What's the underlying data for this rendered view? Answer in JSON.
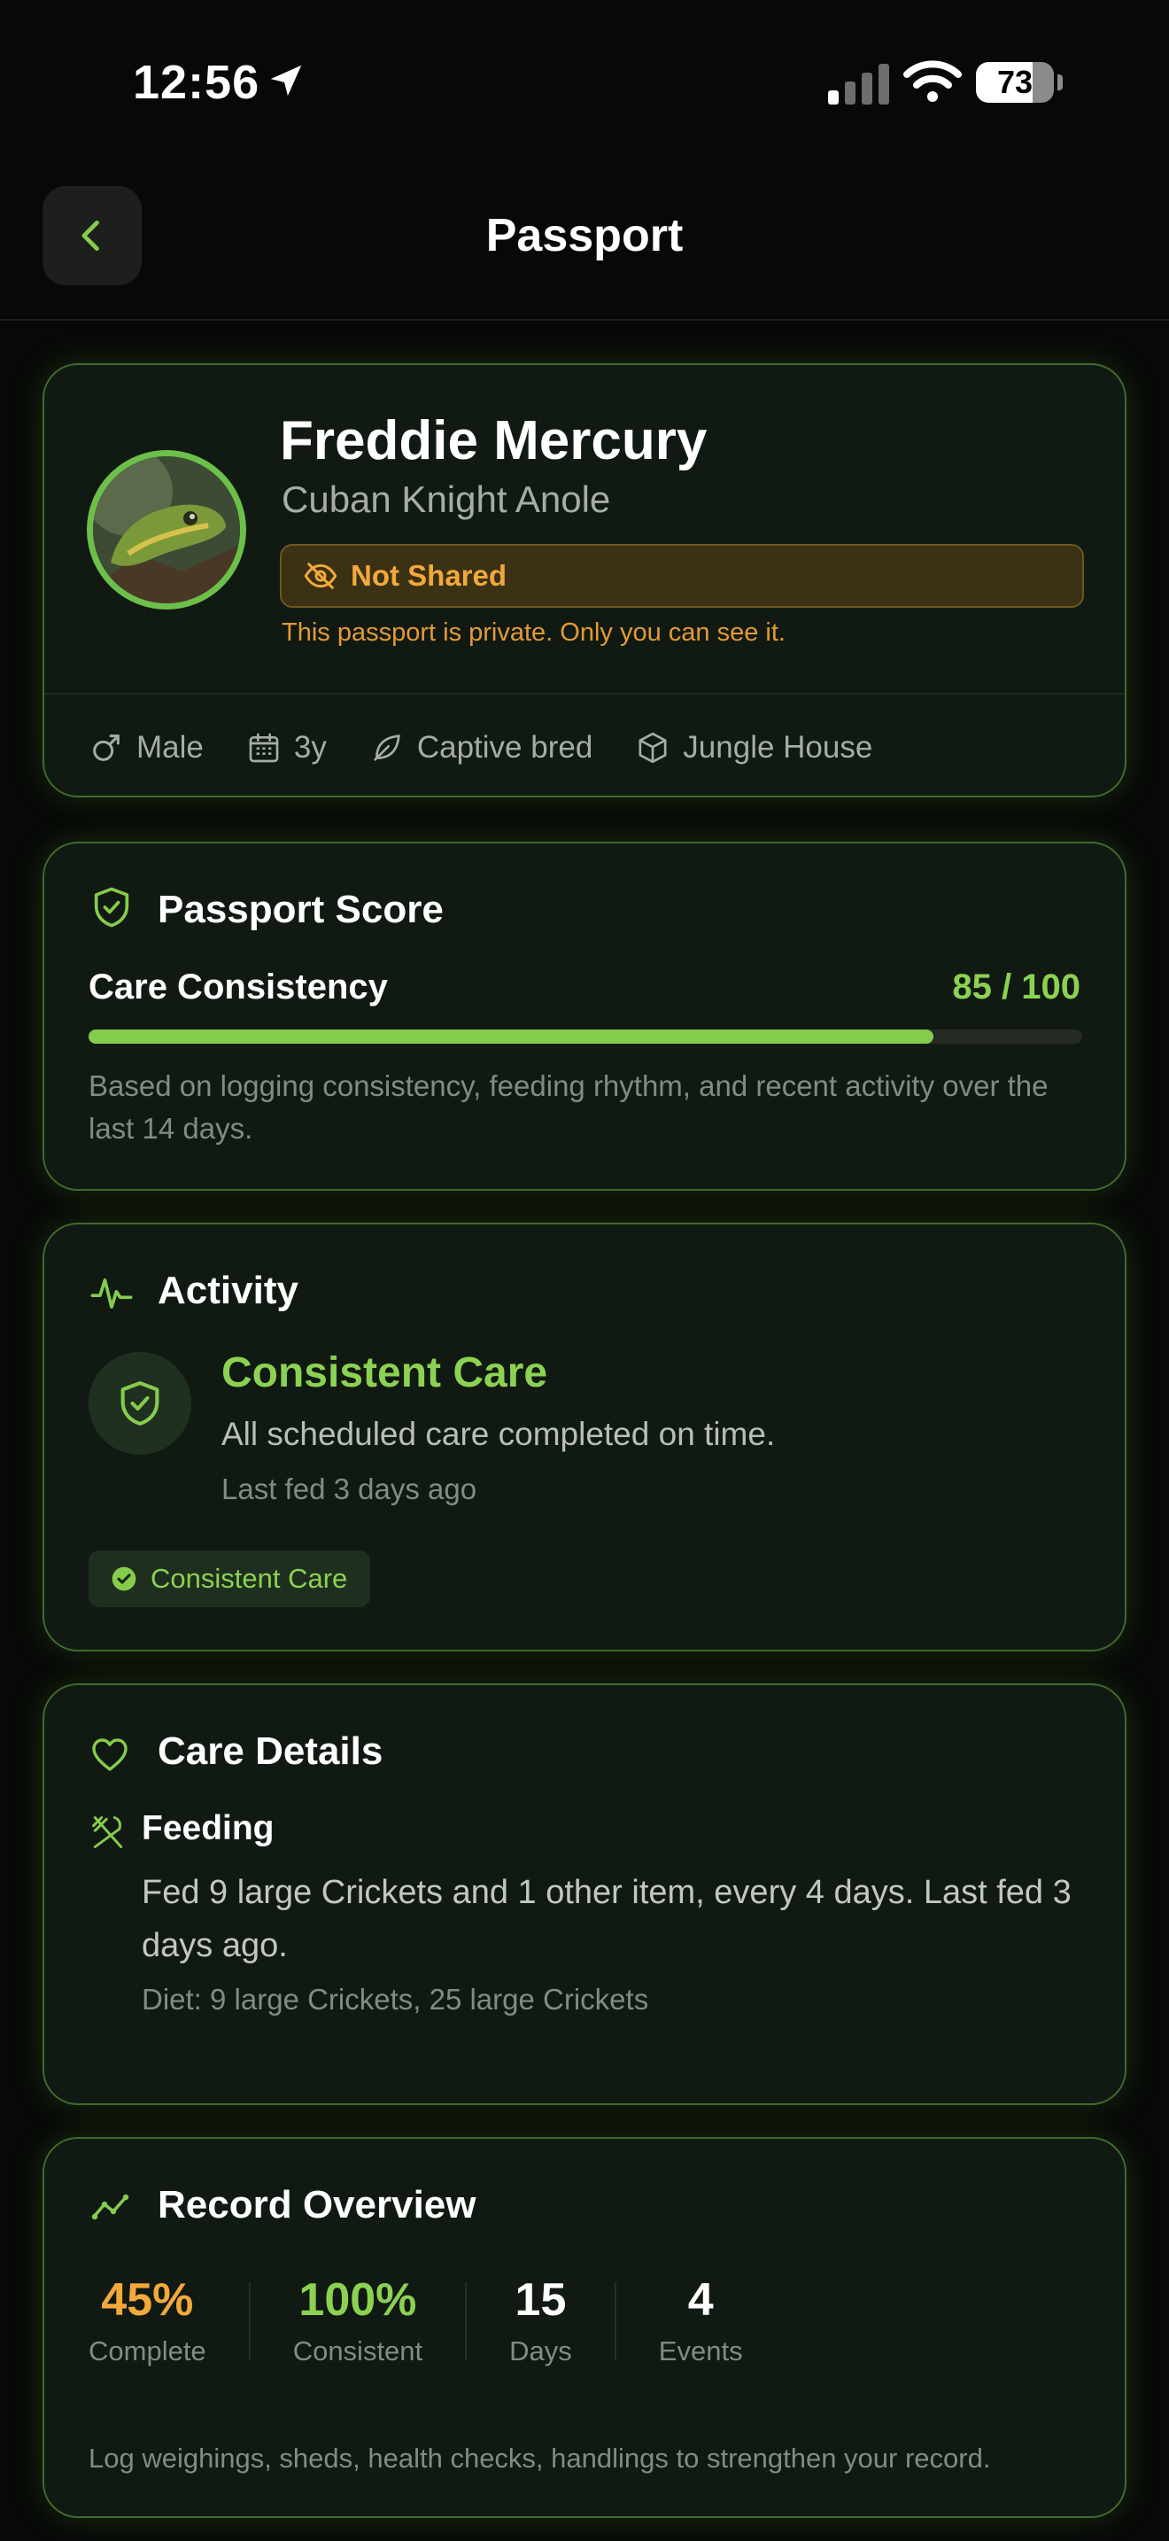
{
  "status_bar": {
    "time": "12:56",
    "battery_percent": "73",
    "battery_level": 0.73
  },
  "nav": {
    "title": "Passport"
  },
  "profile": {
    "name": "Freddie Mercury",
    "species": "Cuban Knight Anole",
    "share_status": "Not Shared",
    "private_note": "This passport is private. Only you can see it.",
    "facts": {
      "sex": "Male",
      "age": "3y",
      "origin": "Captive bred",
      "enclosure": "Jungle House"
    }
  },
  "score": {
    "title": "Passport Score",
    "metric_label": "Care Consistency",
    "metric_value": "85 / 100",
    "score": 85,
    "max": 100,
    "description": "Based on logging consistency, feeding rhythm, and recent activity over the last 14 days."
  },
  "activity": {
    "title": "Activity",
    "status": "Consistent Care",
    "detail": "All scheduled care completed on time.",
    "last_fed": "Last fed 3 days ago",
    "chip": "Consistent Care"
  },
  "care": {
    "title": "Care Details",
    "feeding_label": "Feeding",
    "feeding_desc": "Fed 9 large Crickets and 1 other item, every 4 days. Last fed 3 days ago.",
    "diet": "Diet: 9 large Crickets, 25 large Crickets"
  },
  "record": {
    "title": "Record Overview",
    "stats": [
      {
        "value": "45%",
        "label": "Complete",
        "color": "#f2a93b"
      },
      {
        "value": "100%",
        "label": "Consistent",
        "color": "#8cd252"
      },
      {
        "value": "15",
        "label": "Days",
        "color": "#ffffff"
      },
      {
        "value": "4",
        "label": "Events",
        "color": "#ffffff"
      }
    ],
    "note": "Log weighings, sheds, health checks, handlings to strengthen your record."
  },
  "colors": {
    "accent_green": "#8cd252",
    "warning_orange": "#f2a93b",
    "card_bg": "#111a12",
    "card_border": "#3f6b2c"
  }
}
